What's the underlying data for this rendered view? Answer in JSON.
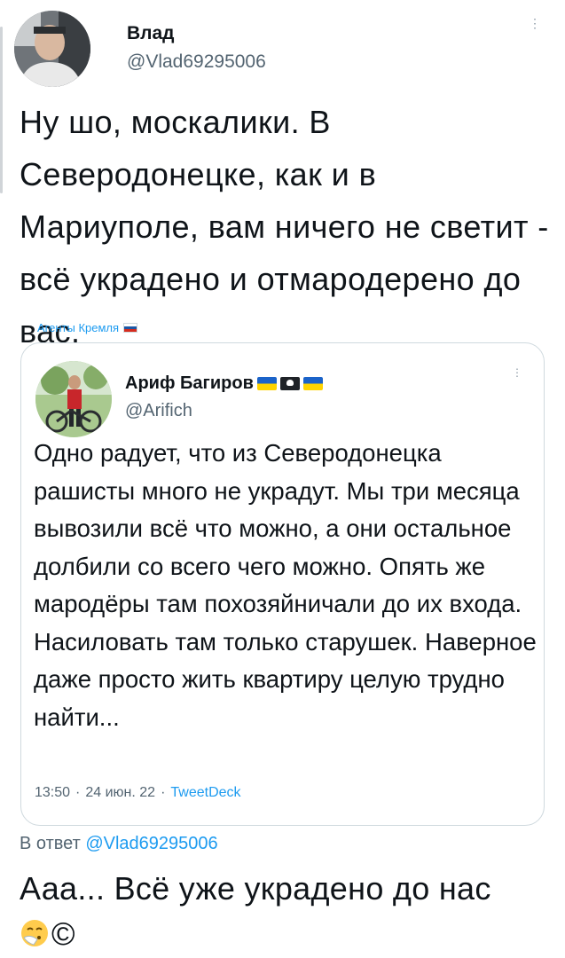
{
  "main_tweet": {
    "author_name": "Влад",
    "author_handle": "@Vlad69295006",
    "text": "Ну шо, москалики. В Северодонецке, как и в Мариуполе, вам ничего не светит - всё украдено и отмародерено до вас.",
    "label": "Агенты Кремля",
    "more_glyph": "⋮"
  },
  "quoted_tweet": {
    "author_name": "Ариф Багиров",
    "author_handle": "@Arifich",
    "text": "Одно радует, что из Северодонецка рашисты много не украдут. Мы три месяца вывозили всё что можно, а они остальное долбили со всего чего можно. Опять же мародёры там похозяйничали до их входа. Насиловать там только старушек. Наверное даже просто жить квартиру целую трудно найти...",
    "time": "13:50",
    "date": "24 июн. 22",
    "separator": "·",
    "source": "TweetDeck",
    "more_glyph": "⋮"
  },
  "reply": {
    "prefix": "В ответ",
    "mention": "@Vlad69295006",
    "text": "Ааа... Всё уже украдено до нас",
    "emoji_icon": "sneezing-face-icon",
    "suffix": "©"
  },
  "colors": {
    "link_blue": "#1d9bf0",
    "secondary_text": "#536471",
    "card_border": "#cfd9de"
  }
}
